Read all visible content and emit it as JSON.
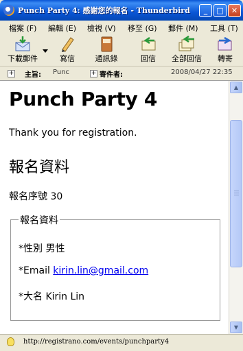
{
  "window": {
    "title": "Punch Party 4: 感謝您的報名 - Thunderbird"
  },
  "menu": [
    "檔案 (F)",
    "編輯 (E)",
    "檢視 (V)",
    "移至 (G)",
    "郵件 (M)",
    "工具 (T)"
  ],
  "toolbar": {
    "get_mail": "下載郵件",
    "write": "寫信",
    "address_book": "通訊錄",
    "reply": "回信",
    "reply_all": "全部回信",
    "forward": "轉寄"
  },
  "header": {
    "subject_label": "主旨:",
    "subject_value": "Punc",
    "from_label": "寄件者:",
    "date": "2008/04/27 22:35"
  },
  "message": {
    "title": "Punch Party 4",
    "thanks": "Thank you for registration.",
    "section_title": "報名資料",
    "reg_no_label": "報名序號",
    "reg_no_value": "30",
    "fieldset_legend": "報名資料",
    "gender": "*性別 男性",
    "email_label": "*Email",
    "email_value": "kirin.lin@gmail.com",
    "name": "*大名 Kirin Lin"
  },
  "status": {
    "url": "http://registrano.com/events/punchparty4"
  },
  "colors": {
    "titlebar": "#0a56d6",
    "link": "#0000ee"
  }
}
